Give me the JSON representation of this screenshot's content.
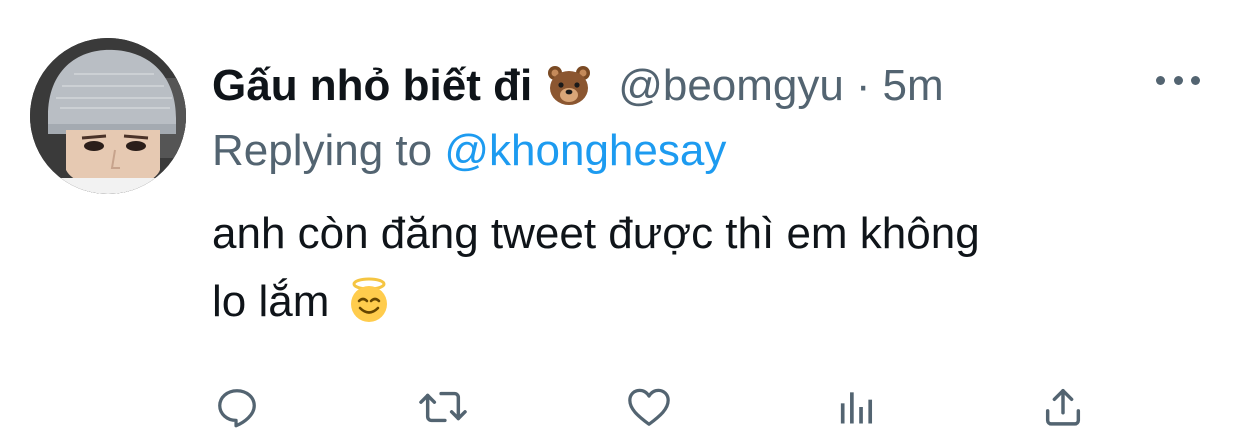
{
  "tweet": {
    "display_name": "Gấu nhỏ biết đi",
    "name_emoji": "bear-face-emoji",
    "handle": "@beomgyu",
    "separator": "·",
    "time": "5m",
    "replying_prefix": "Replying to",
    "replying_handle": "@khonghesay",
    "body_line_1": "anh còn đăng tweet được thì em không",
    "body_line_2": "lo lắm",
    "body_emoji": "smiling-face-with-halo-emoji"
  },
  "actions": {
    "icons": [
      "reply-icon",
      "retweet-icon",
      "like-icon",
      "analytics-icon",
      "share-icon"
    ]
  },
  "colors": {
    "text_primary": "#0f1419",
    "text_secondary": "#536471",
    "link": "#1d9bf0"
  }
}
